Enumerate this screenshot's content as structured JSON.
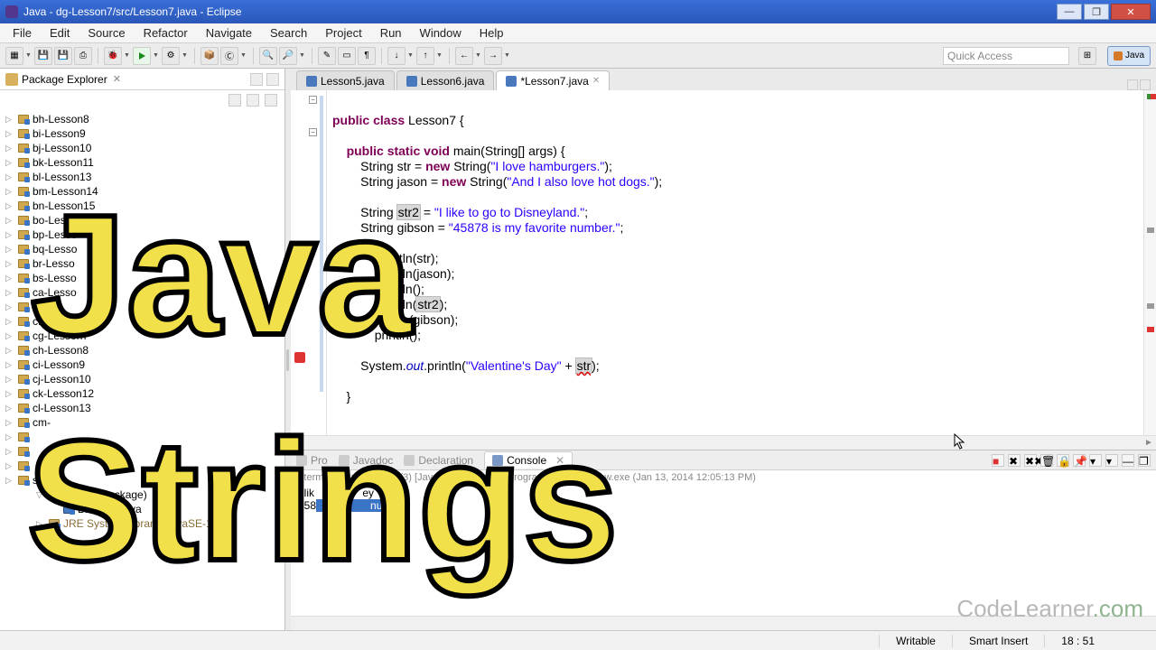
{
  "window": {
    "title": "Java - dg-Lesson7/src/Lesson7.java - Eclipse",
    "min": "—",
    "max": "❐",
    "close": "✕"
  },
  "menu": [
    "File",
    "Edit",
    "Source",
    "Refactor",
    "Navigate",
    "Search",
    "Project",
    "Run",
    "Window",
    "Help"
  ],
  "quick_access": "Quick Access",
  "perspective": "Java",
  "package_explorer": {
    "title": "Package Explorer"
  },
  "tree": [
    "bh-Lesson8",
    "bi-Lesson9",
    "bj-Lesson10",
    "bk-Lesson11",
    "bl-Lesson13",
    "bm-Lesson14",
    "bn-Lesson15",
    "bo-Lesso",
    "bp-Lesso",
    "bq-Lesso",
    "br-Lesso",
    "bs-Lesso",
    "ca-Lesso",
    "esso",
    "cf-Lesson6",
    "cg-Lesson7",
    "ch-Lesson8",
    "ci-Lesson9",
    "cj-Lesson10",
    "ck-Lesson12",
    "cl-Lesson13"
  ],
  "tree_extra": {
    "default_package": "(default package)",
    "java_file": "Lesson7.java",
    "jre": "JRE System Library [JavaSE-1.7]"
  },
  "tabs": [
    {
      "label": "Lesson5.java",
      "active": false,
      "dirty": false
    },
    {
      "label": "Lesson6.java",
      "active": false,
      "dirty": false
    },
    {
      "label": "*Lesson7.java",
      "active": true,
      "dirty": true
    }
  ],
  "code": {
    "l1a": "public",
    "l1b": "class",
    "l1c": " Lesson7 {",
    "l2a": "public",
    "l2b": "static",
    "l2c": "void",
    "l2d": " main(String[] args) {",
    "l3a": "        String str = ",
    "l3b": "new",
    "l3c": " String(",
    "l3d": "\"I love hamburgers.\"",
    "l3e": ");",
    "l4a": "        String jason = ",
    "l4b": "new",
    "l4c": " String(",
    "l4d": "\"And I also love hot dogs.\"",
    "l4e": ");",
    "l5a": "        String ",
    "l5var": "str2",
    "l5b": " = ",
    "l5s": "\"I like to go to Disneyland.\"",
    "l5c": ";",
    "l6a": "        String gibson = ",
    "l6s": "\"45878 is my favorite number.\"",
    "l6b": ";",
    "l7a": "            ",
    "l7b": ".println(str);",
    "l8a": "            ",
    "l8b": ".println(jason);",
    "l9a": "            ",
    "l9b": ".println();",
    "l10a": "            ",
    "l10b": ".println(",
    "l10var": "str2",
    "l10c": ");",
    "l11a": "            ",
    "l11b": "println(gibson);",
    "l12a": "            ",
    "l12b": "println();",
    "l13a": "        System.",
    "l13out": "out",
    "l13b": ".println(",
    "l13s": "\"Valentine's Day\"",
    "l13c": " + ",
    "l13var": "str",
    "l13d": ");",
    "l14": "    }"
  },
  "console_tabs": {
    "problems": "Pro",
    "javadoc": "Javadoc",
    "declaration": "Declaration",
    "console": "Console"
  },
  "console_header": "<terminated> Lesson7 (3) [Java Application] C:\\Program                  \\jre7\\bin\\javaw.exe (Jan 13, 2014 12:05:13 PM)",
  "console_out": {
    "l1": "I lik        t       ey",
    "l2a": "458",
    "l2sel": "      fa         nu",
    "l2b": ""
  },
  "status": {
    "writable": "Writable",
    "insert": "Smart Insert",
    "pos": "18 : 51"
  },
  "overlay": {
    "big1": "Java",
    "big2": "Strings"
  },
  "watermark": {
    "a": "CodeLearner",
    "b": ".com"
  }
}
